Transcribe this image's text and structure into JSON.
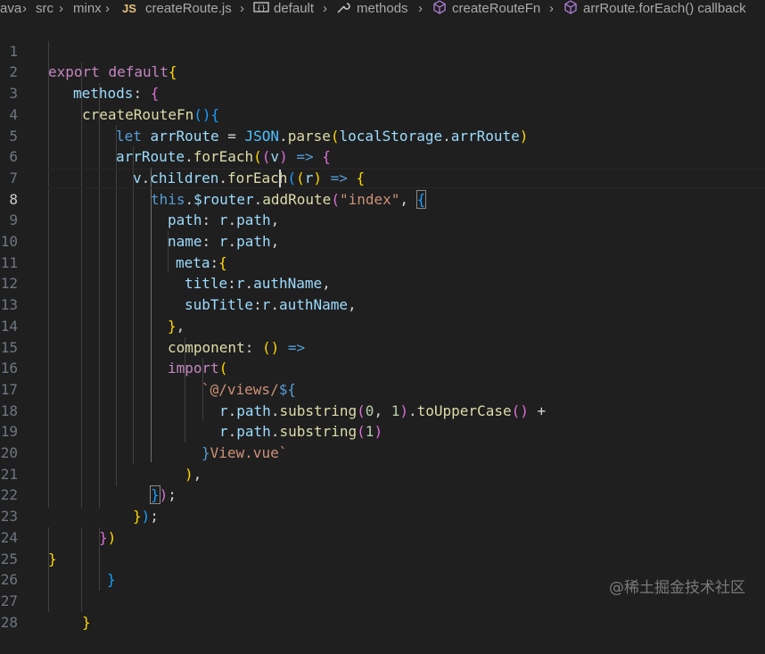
{
  "breadcrumb": {
    "segments": [
      "ava",
      "src",
      "minx",
      "createRoute.js",
      "default",
      "methods",
      "createRouteFn",
      "arrRoute.forEach() callback"
    ],
    "file_badge": "JS"
  },
  "editor": {
    "active_line": 8,
    "lines": [
      {
        "n": "1"
      },
      {
        "n": "2"
      },
      {
        "n": "3"
      },
      {
        "n": "4"
      },
      {
        "n": "5"
      },
      {
        "n": "6"
      },
      {
        "n": "7"
      },
      {
        "n": "8"
      },
      {
        "n": "9"
      },
      {
        "n": "10"
      },
      {
        "n": "11"
      },
      {
        "n": "12"
      },
      {
        "n": "13"
      },
      {
        "n": "14"
      },
      {
        "n": "15"
      },
      {
        "n": "16"
      },
      {
        "n": "17"
      },
      {
        "n": "18"
      },
      {
        "n": "19"
      },
      {
        "n": "20"
      },
      {
        "n": "21"
      },
      {
        "n": "22"
      },
      {
        "n": "23"
      },
      {
        "n": "24"
      },
      {
        "n": "25"
      },
      {
        "n": "26"
      },
      {
        "n": "27"
      },
      {
        "n": "28"
      }
    ],
    "tokens": {
      "l1": [
        "export",
        " ",
        "default",
        "{"
      ],
      "l2": [
        "methods",
        ":",
        " ",
        "{"
      ],
      "l3": [
        "createRouteFn",
        "(",
        ")",
        "{"
      ],
      "l4": [
        "let",
        " ",
        "arrRoute",
        " = ",
        "JSON",
        ".",
        "parse",
        "(",
        "localStorage",
        ".",
        "arrRoute",
        ")"
      ],
      "l5": [
        "arrRoute",
        ".",
        "forEach",
        "(",
        "(",
        "v",
        ")",
        " ",
        "=>",
        " ",
        "{"
      ],
      "l6": [
        "v",
        ".",
        "children",
        ".",
        "forEach",
        "(",
        "(",
        "r",
        ")",
        " ",
        "=>",
        " ",
        "{"
      ],
      "l7": [
        "this",
        ".",
        "$router",
        ".",
        "addRoute",
        "(",
        "\"index\"",
        ", ",
        "{"
      ],
      "l8": [
        "path",
        ": ",
        "r",
        ".",
        "path",
        ","
      ],
      "l9": [
        "name",
        ": ",
        "r",
        ".",
        "path",
        ","
      ],
      "l10": [
        "meta",
        ":",
        "{"
      ],
      "l11": [
        "title",
        ":",
        "r",
        ".",
        "authName",
        ","
      ],
      "l12": [
        "subTitle",
        ":",
        "r",
        ".",
        "authName",
        ","
      ],
      "l13": [
        "}",
        ","
      ],
      "l14": [
        "component",
        ": ",
        "(",
        ")",
        " ",
        "=>"
      ],
      "l15": [
        "import",
        "("
      ],
      "l16": [
        "`@/views/",
        "${"
      ],
      "l17": [
        "r",
        ".",
        "path",
        ".",
        "substring",
        "(",
        "0",
        ", ",
        "1",
        ")",
        ".",
        "toUpperCase",
        "(",
        ")",
        " +"
      ],
      "l18": [
        "r",
        ".",
        "path",
        ".",
        "substring",
        "(",
        "1",
        ")"
      ],
      "l19": [
        "}",
        "View.vue`"
      ],
      "l20": [
        ")",
        ","
      ],
      "l21": [
        "}",
        ")",
        ";"
      ],
      "l22": [
        "}",
        ")",
        ";"
      ],
      "l23": [
        "}",
        ")"
      ],
      "l24": [
        "}"
      ],
      "l25": [
        "}"
      ],
      "l27": [
        "}"
      ]
    }
  },
  "watermark": "@稀土掘金技术社区"
}
